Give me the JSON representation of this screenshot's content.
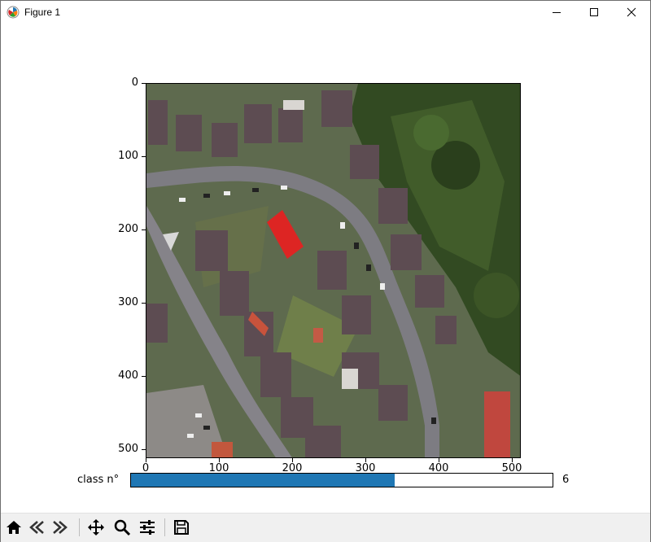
{
  "window": {
    "title": "Figure 1"
  },
  "plot": {
    "y_ticks": [
      "0",
      "100",
      "200",
      "300",
      "400",
      "500"
    ],
    "x_ticks": [
      "0",
      "100",
      "200",
      "300",
      "400",
      "500"
    ]
  },
  "slider": {
    "label": "class n°",
    "value": "6",
    "fill_fraction": 0.625
  },
  "colors": {
    "slider_fill": "#1f77b4",
    "highlight": "#e82020"
  },
  "toolbar": {
    "buttons": [
      {
        "icon": "home-icon"
      },
      {
        "icon": "back-arrow-icon"
      },
      {
        "icon": "forward-arrow-icon"
      },
      {
        "icon": "pan-icon"
      },
      {
        "icon": "zoom-icon"
      },
      {
        "icon": "configure-subplots-icon"
      },
      {
        "icon": "save-icon"
      }
    ]
  }
}
